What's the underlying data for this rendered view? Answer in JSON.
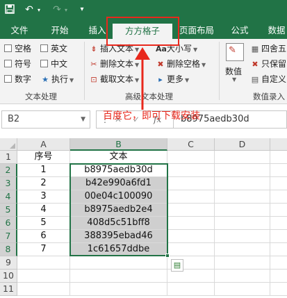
{
  "quick_access": {
    "save_icon": "save-icon",
    "undo_icon": "undo-icon",
    "redo_icon": "redo-icon",
    "customize_icon": "customize-qat-icon"
  },
  "tabs": [
    {
      "label": "文件"
    },
    {
      "label": "开始"
    },
    {
      "label": "插入"
    },
    {
      "label": "方方格子"
    },
    {
      "label": "页面布局"
    },
    {
      "label": "公式"
    },
    {
      "label": "数据"
    }
  ],
  "ribbon": {
    "text_group": {
      "label": "文本处理",
      "checkboxes": [
        {
          "label": "空格"
        },
        {
          "label": "英文"
        },
        {
          "label": "符号"
        },
        {
          "label": "中文"
        },
        {
          "label": "数字"
        }
      ],
      "execute": "执行"
    },
    "advanced_group": {
      "label": "高级文本处理",
      "items": [
        {
          "label": "插入文本"
        },
        {
          "label": "删除文本"
        },
        {
          "label": "截取文本"
        },
        {
          "label": "大小写"
        },
        {
          "label": "删除空格"
        },
        {
          "label": "更多"
        }
      ]
    },
    "data_group": {
      "label": "数值录入",
      "big_button": "数值",
      "items": [
        {
          "label": "四舍五"
        },
        {
          "label": "只保留"
        },
        {
          "label": "自定义"
        }
      ]
    }
  },
  "formula_bar": {
    "name_box": "B2",
    "fx": "fx",
    "value": "b8975aedb30d"
  },
  "grid": {
    "columns": [
      "A",
      "B",
      "C",
      "D"
    ],
    "rows": [
      "1",
      "2",
      "3",
      "4",
      "5",
      "6",
      "7",
      "8",
      "9",
      "10",
      "11"
    ],
    "header_row": [
      "序号",
      "文本"
    ],
    "data": [
      [
        "1",
        "b8975aedb30d"
      ],
      [
        "2",
        "b42e990a6fd1"
      ],
      [
        "3",
        "00e04c100090"
      ],
      [
        "4",
        "b8975aedb2e4"
      ],
      [
        "5",
        "408d5c51bff8"
      ],
      [
        "6",
        "388395ebad46"
      ],
      [
        "7",
        "1c61657ddbe"
      ]
    ]
  },
  "annotation": {
    "text": "百度它，即可下载安装",
    "color": "#e8281c"
  },
  "colors": {
    "accent": "#217346",
    "annotation": "#e8281c",
    "selection_fill": "#cfcfcf"
  }
}
